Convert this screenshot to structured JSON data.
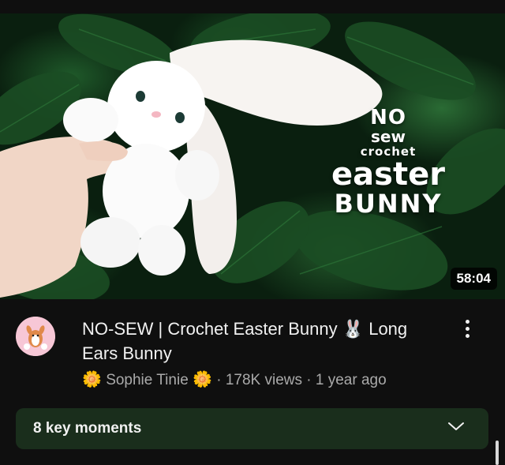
{
  "thumbnail": {
    "title_art": {
      "line1": "NO",
      "line2": "sew",
      "line3": "crochet",
      "line4": "easter",
      "line5": "BUNNY"
    },
    "duration": "58:04"
  },
  "video": {
    "title": "NO-SEW | Crochet Easter Bunny 🐰 Long Ears Bunny",
    "channel": "Sophie Tinie",
    "channel_prefix_icon": "🌼",
    "channel_suffix_icon": "🌼",
    "stats": "· 178K views · 1 year ago"
  },
  "key_moments": {
    "label": "8 key moments"
  },
  "colors": {
    "background": "#0f0f0f",
    "moments_bg": "#1a2e1c",
    "text_primary": "#f1f1f1",
    "text_secondary": "#aaaaaa"
  }
}
